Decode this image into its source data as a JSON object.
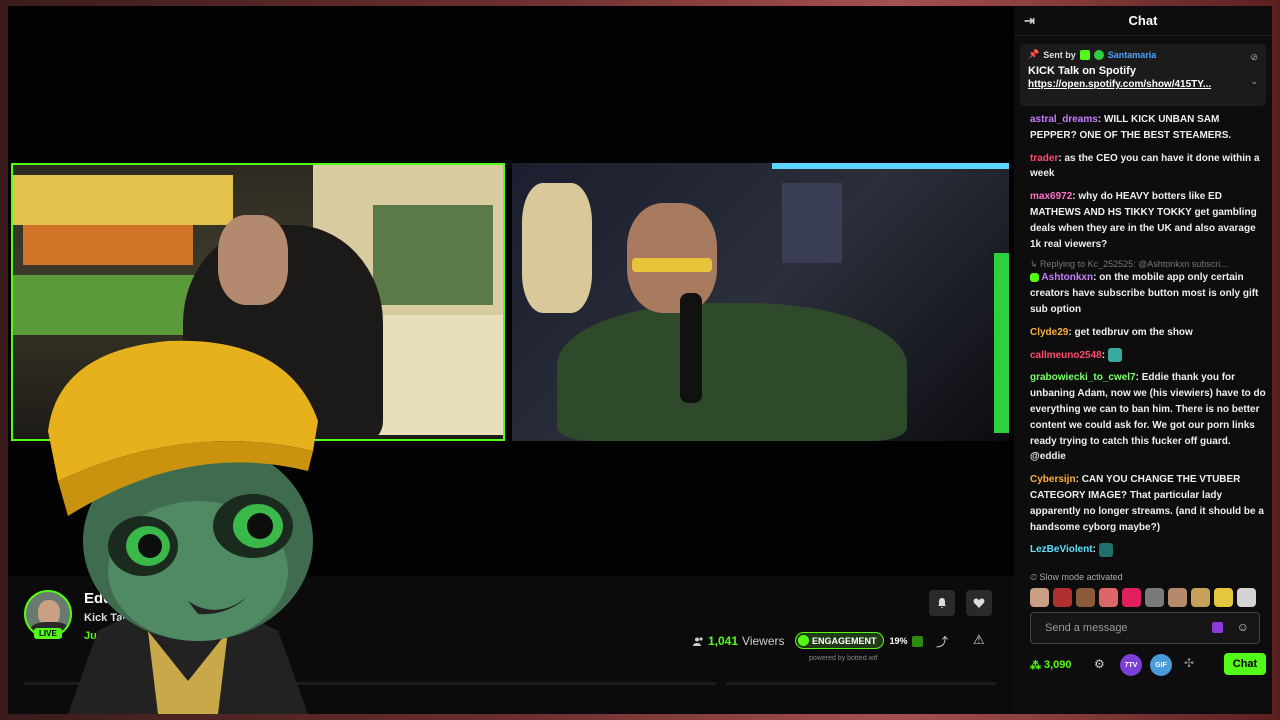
{
  "chat": {
    "header_title": "Chat",
    "pinned": {
      "sent_by_label": "Sent by",
      "sender": "Santamaria",
      "title": "KICK Talk on Spotify",
      "link": "https://open.spotify.com/show/415TY..."
    },
    "messages": [
      {
        "user": "astral_dreams",
        "color": "#c77dff",
        "text": "WILL KICK UNBAN SAM PEPPER? ONE OF THE BEST STEAMERS."
      },
      {
        "user": "trader",
        "color": "#ff4b6e",
        "text": "as the CEO you can have it done within a week"
      },
      {
        "user": "max6972",
        "color": "#ff6fc8",
        "text": "why do HEAVY botters like ED MATHEWS AND HS TIKKY TOKKY get gambling deals when they are in the UK and also avarage 1k real viewers?"
      },
      {
        "reply": "Replying to Kc_252525: @Ashtonkxn subscri...",
        "user": "Ashtonkxn",
        "color": "#c77dff",
        "text": "on the mobile app only certain creators have subscribe button most is only gift sub option"
      },
      {
        "user": "Clyde29",
        "color": "#ffb03b",
        "text": "get tedbruv om the show"
      },
      {
        "user": "callmeuno2548",
        "color": "#ff4b6e",
        "text": ""
      },
      {
        "user": "grabowiecki_to_cwel7",
        "color": "#7bff6a",
        "text": "Eddie thank you for unbaning Adam, now we (his viewiers) have to do everything we can to ban him. There is no better content we could ask for. We got our porn links ready trying to catch this fucker off guard. @eddie"
      },
      {
        "user": "Cybersiјn",
        "color": "#ffb03b",
        "text": "CAN YOU CHANGE THE VTUBER CATEGORY IMAGE? That particular lady apparently no longer streams. (and it should be a handsome cyborg maybe?)"
      },
      {
        "user": "LezBeViolent",
        "color": "#5ce1ff",
        "text": ""
      }
    ],
    "slow_mode": "Slow mode activated",
    "input_placeholder": "Send a message",
    "points": "3,090",
    "badge_7tv": "7TV",
    "badge_gif": "GIF",
    "send_label": "Chat"
  },
  "channel": {
    "name": "Eddie",
    "title": "Kick Talk Epis",
    "category": "Just Chatti",
    "live_badge": "LIVE",
    "viewers_count": "1,041",
    "viewers_label": "Viewers",
    "engagement_label": "ENGAGEMENT",
    "engagement_value": "19%",
    "powered_by": "powered by botted.wtf"
  },
  "colors": {
    "accent": "#53fc18"
  }
}
